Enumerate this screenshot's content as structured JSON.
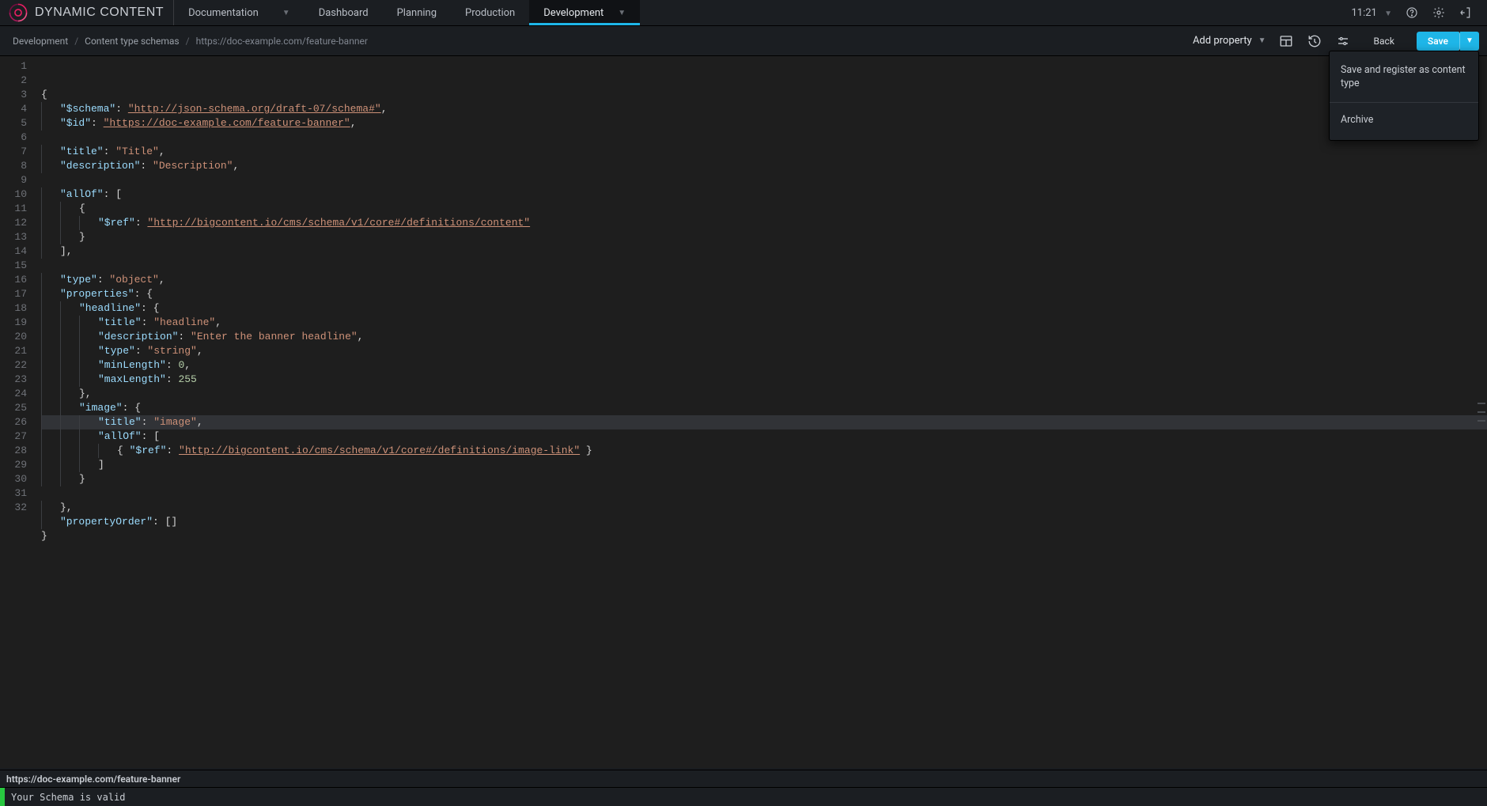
{
  "brand": {
    "name": "DYNAMIC CONTENT"
  },
  "topnav": {
    "documentation": "Documentation",
    "tabs": [
      {
        "label": "Dashboard"
      },
      {
        "label": "Planning"
      },
      {
        "label": "Production"
      },
      {
        "label": "Development",
        "active": true,
        "hasChevron": true
      }
    ],
    "clock": "11:21"
  },
  "toolbar": {
    "breadcrumbs": {
      "a": "Development",
      "b": "Content type schemas",
      "c": "https://doc-example.com/feature-banner"
    },
    "add_property": "Add property",
    "back": "Back",
    "save": "Save",
    "save_menu": {
      "item1": "Save and register as content type",
      "item2": "Archive"
    }
  },
  "editor": {
    "line_count": 32,
    "highlighted_line": 24,
    "tokens": {
      "schema_key": "\"$schema\"",
      "schema_val": "\"http://json-schema.org/draft-07/schema#\"",
      "id_key": "\"$id\"",
      "id_val": "\"https://doc-example.com/feature-banner\"",
      "title_key": "\"title\"",
      "title_val": "\"Title\"",
      "desc_key": "\"description\"",
      "desc_val": "\"Description\"",
      "allof_key": "\"allOf\"",
      "ref_key": "\"$ref\"",
      "ref_val": "\"http://bigcontent.io/cms/schema/v1/core#/definitions/content\"",
      "type_key": "\"type\"",
      "type_val": "\"object\"",
      "props_key": "\"properties\"",
      "headline_key": "\"headline\"",
      "headline_title_val": "\"headline\"",
      "headline_desc_val": "\"Enter the banner headline\"",
      "string_val": "\"string\"",
      "minlen_key": "\"minLength\"",
      "minlen_val": "0",
      "maxlen_key": "\"maxLength\"",
      "maxlen_val": "255",
      "image_key": "\"image\"",
      "image_title_val": "\"image\"",
      "image_ref_val": "\"http://bigcontent.io/cms/schema/v1/core#/definitions/image-link\"",
      "porder_key": "\"propertyOrder\""
    }
  },
  "status": {
    "file": "https://doc-example.com/feature-banner",
    "message": "Your Schema is valid"
  }
}
